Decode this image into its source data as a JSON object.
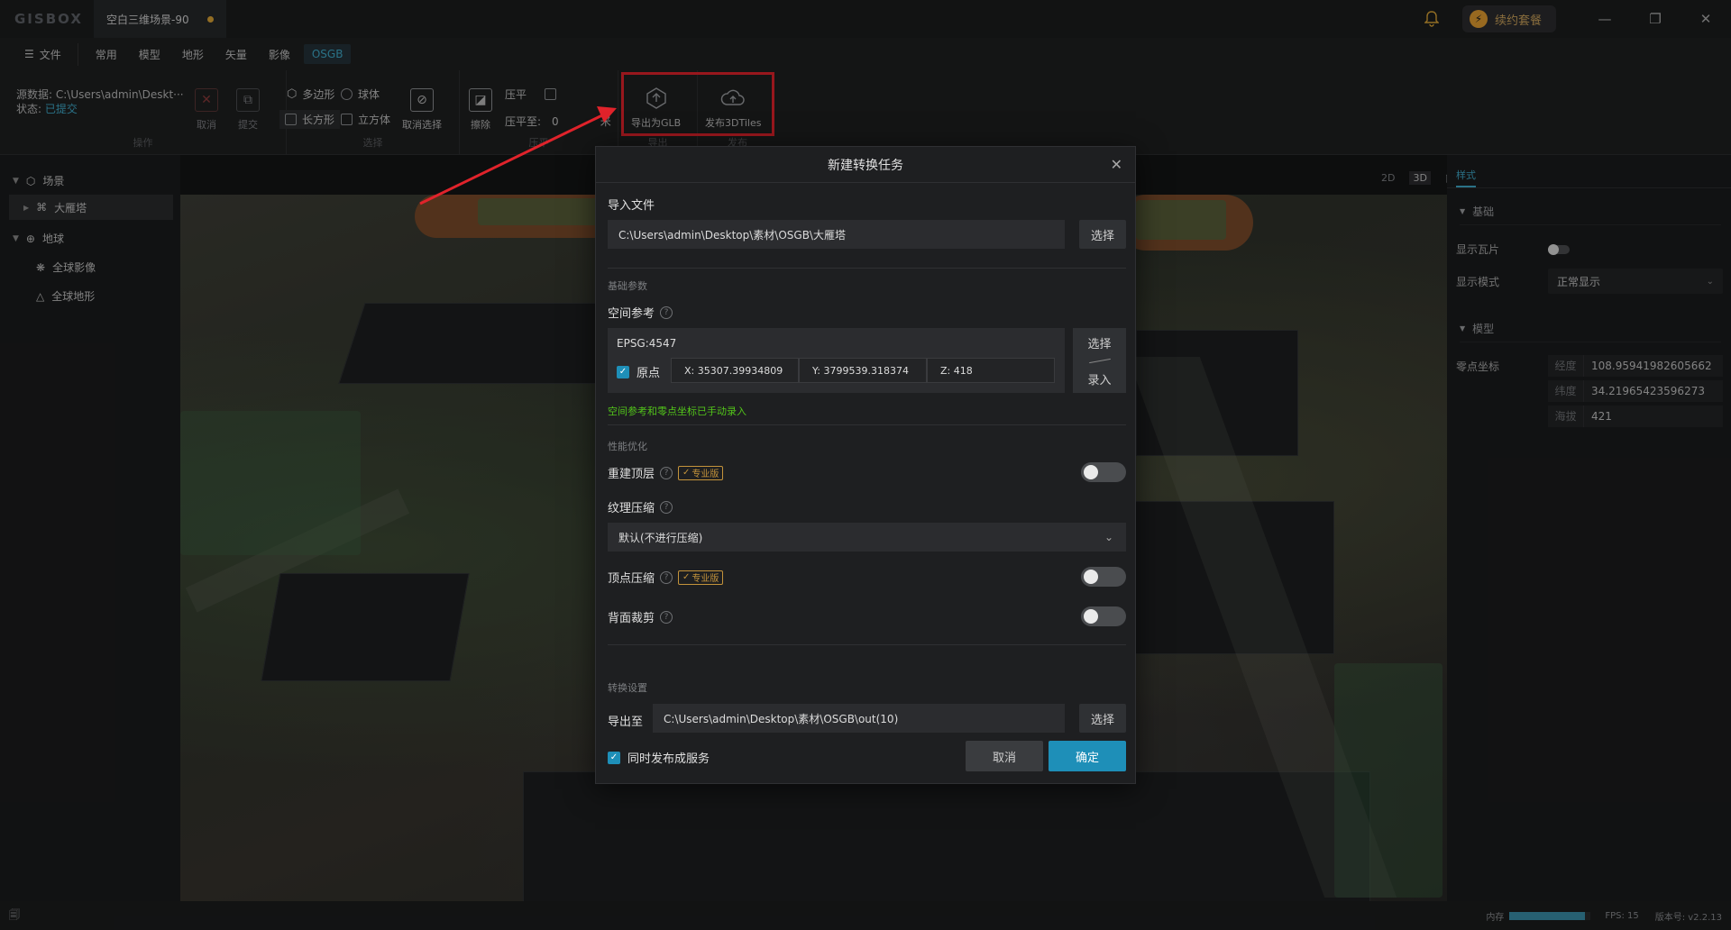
{
  "app": {
    "logo": "GISBOX",
    "tab_title": "空白三维场景-90",
    "renew": "续约套餐"
  },
  "menu": {
    "file": "文件",
    "items": [
      "常用",
      "模型",
      "地形",
      "矢量",
      "影像",
      "OSGB"
    ],
    "active": "OSGB"
  },
  "ribbon": {
    "source_label": "源数据:",
    "source_value": "C:\\Users\\admin\\Deskt···",
    "state_label": "状态:",
    "state_value": "已提交",
    "cancel": "取消",
    "submit": "提交",
    "group_op": "操作",
    "polygon": "多边形",
    "sphere": "球体",
    "rect": "长方形",
    "cube": "立方体",
    "cancel_select": "取消选择",
    "group_select": "选择",
    "erase": "擦除",
    "flatten": "压平",
    "flatten_to": "压平至:",
    "flatten_value": "0",
    "unit": "米",
    "group_flatten": "压平",
    "export_glb": "导出为GLB",
    "publish_3dtiles": "发布3DTiles",
    "group_export": "导出",
    "group_publish": "发布"
  },
  "tree": {
    "scene": "场景",
    "pagoda": "大雁塔",
    "earth": "地球",
    "global_imagery": "全球影像",
    "global_terrain": "全球地形"
  },
  "view_modes": [
    "2D",
    "3D",
    "◫"
  ],
  "right_panel": {
    "tab": "样式",
    "basic": "基础",
    "show_tiles": "显示瓦片",
    "show_mode": "显示模式",
    "show_mode_value": "正常显示",
    "model": "模型",
    "origin_coord": "零点坐标",
    "lon_k": "经度",
    "lon_v": "108.95941982605662",
    "lat_k": "纬度",
    "lat_v": "34.21965423596273",
    "alt_k": "海拔",
    "alt_v": "421"
  },
  "dialog": {
    "title": "新建转换任务",
    "import_file": "导入文件",
    "import_path": "C:\\Users\\admin\\Desktop\\素材\\OSGB\\大雁塔",
    "choose": "选择",
    "basic_params": "基础参数",
    "spatial_ref": "空间参考",
    "epsg": "EPSG:4547",
    "origin": "原点",
    "x_k": "X:",
    "x_v": "35307.39934809",
    "y_k": "Y:",
    "y_v": "3799539.318374",
    "z_k": "Z:",
    "z_v": "418",
    "pick_choose": "选择",
    "pick_enter": "录入",
    "note": "空间参考和零点坐标已手动录入",
    "perf": "性能优化",
    "rebuild_top": "重建顶层",
    "pro": "专业版",
    "texture_compress": "纹理压缩",
    "texture_value": "默认(不进行压缩)",
    "vertex_compress": "顶点压缩",
    "backface_cull": "背面裁剪",
    "convert_settings": "转换设置",
    "export_to": "导出至",
    "export_path": "C:\\Users\\admin\\Desktop\\素材\\OSGB\\out(10)",
    "publish_service": "同时发布成服务",
    "cancel": "取消",
    "ok": "确定"
  },
  "status": {
    "memory": "内存",
    "memory_level": 0.93,
    "fps": "FPS: 15",
    "version": "版本号: v2.2.13"
  },
  "colors": {
    "accent": "#1e8fb8",
    "highlight": "#e0232b",
    "success": "#52c41a",
    "pro": "#c4933b"
  }
}
